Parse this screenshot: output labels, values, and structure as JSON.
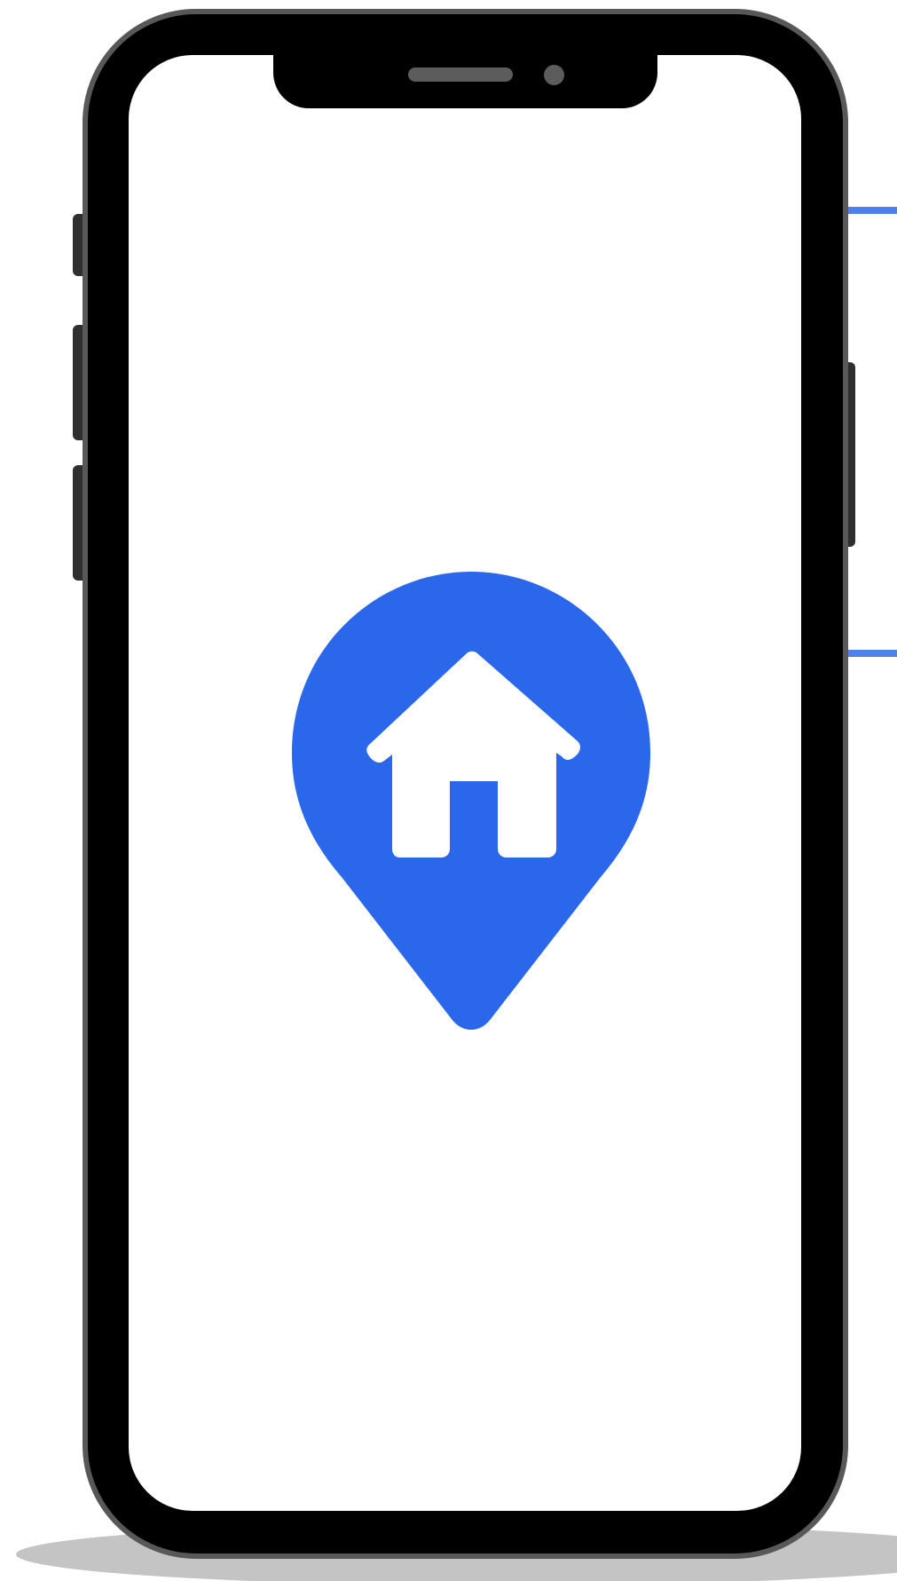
{
  "colors": {
    "accent": "#2a67ea",
    "guide_line": "#4f80ea",
    "phone_frame": "#000000",
    "phone_bezel": "#585858",
    "screen": "#ffffff"
  },
  "icons": {
    "pin": "location-pin-icon",
    "house": "home-icon"
  }
}
